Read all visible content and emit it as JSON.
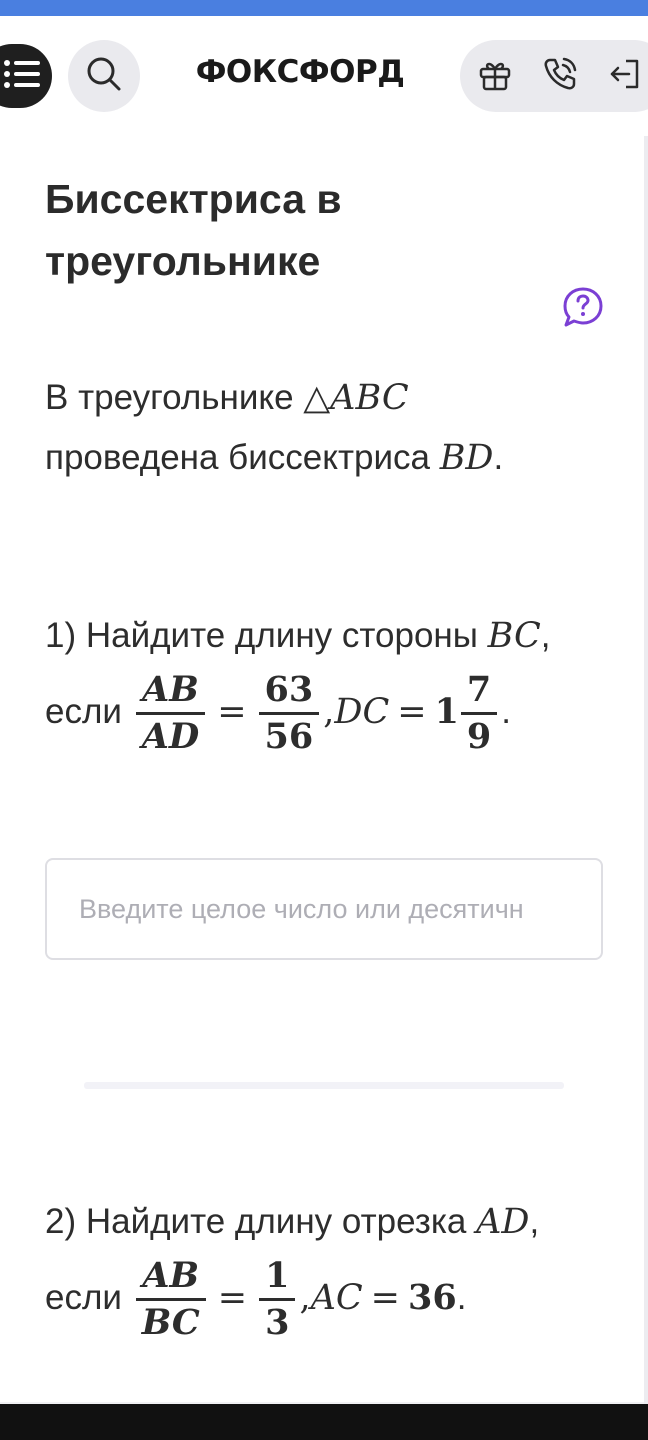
{
  "header": {
    "logo": "ФОКСФОРД",
    "icons": [
      "menu-icon",
      "search-icon",
      "gift-icon",
      "phone-icon",
      "login-icon"
    ]
  },
  "lesson": {
    "title": "Биссектриса в треугольнике",
    "help_icon": "question-bubble-icon",
    "intro_line1_text": "В треугольнике ",
    "intro_line1_math": "△ABC",
    "intro_line2_text": "проведена биссектриса ",
    "intro_line2_math": "BD",
    "intro_line2_end": "."
  },
  "task1": {
    "prefix": "1) Найдите длину стороны ",
    "target": "BC",
    "comma": ",",
    "if_word": "если",
    "frac_num": "AB",
    "frac_den": "AD",
    "eq": "=",
    "val_num": "63",
    "val_den": "56",
    "sep": ",",
    "seg": "DC",
    "eq2": "=",
    "whole": "1",
    "mix_num": "7",
    "mix_den": "9",
    "end": "."
  },
  "answer_input": {
    "placeholder": "Введите целое число или десятичн",
    "value": ""
  },
  "task2": {
    "prefix": "2) Найдите длину отрезка ",
    "target": "AD",
    "comma": ",",
    "if_word": "если",
    "frac_num": "AB",
    "frac_den": "BC",
    "eq": "=",
    "val_num": "1",
    "val_den": "3",
    "sep": ",",
    "seg": "AC",
    "eq2": "=",
    "value": "36",
    "end": "."
  },
  "colors": {
    "accent_top": "#4a7fe0",
    "help_purple": "#7b3fd4",
    "dark": "#1f1f1f"
  }
}
